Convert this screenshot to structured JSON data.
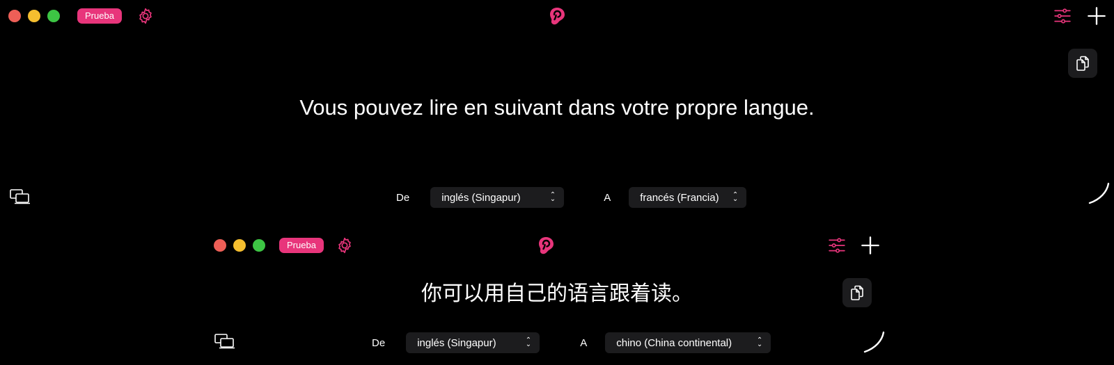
{
  "colors": {
    "accent": "#e8357b",
    "traffic_red": "#ed5f57",
    "traffic_yellow": "#f5be2f",
    "traffic_green": "#3dc544",
    "control_bg": "#1c1c1e"
  },
  "windows": [
    {
      "badge": "Prueba",
      "translated_text": "Vous pouvez lire en suivant dans votre propre langue.",
      "from_label": "De",
      "from_language": "inglés (Singapur)",
      "to_label": "A",
      "to_language": "francés (Francia)"
    },
    {
      "badge": "Prueba",
      "translated_text": "你可以用自己的语言跟着读。",
      "from_label": "De",
      "from_language": "inglés (Singapur)",
      "to_label": "A",
      "to_language": "chino (China continental)"
    }
  ],
  "icons": [
    "gear-icon",
    "app-logo-icon",
    "sliders-icon",
    "plus-icon",
    "copy-icon",
    "screens-icon",
    "spinner-icon"
  ]
}
